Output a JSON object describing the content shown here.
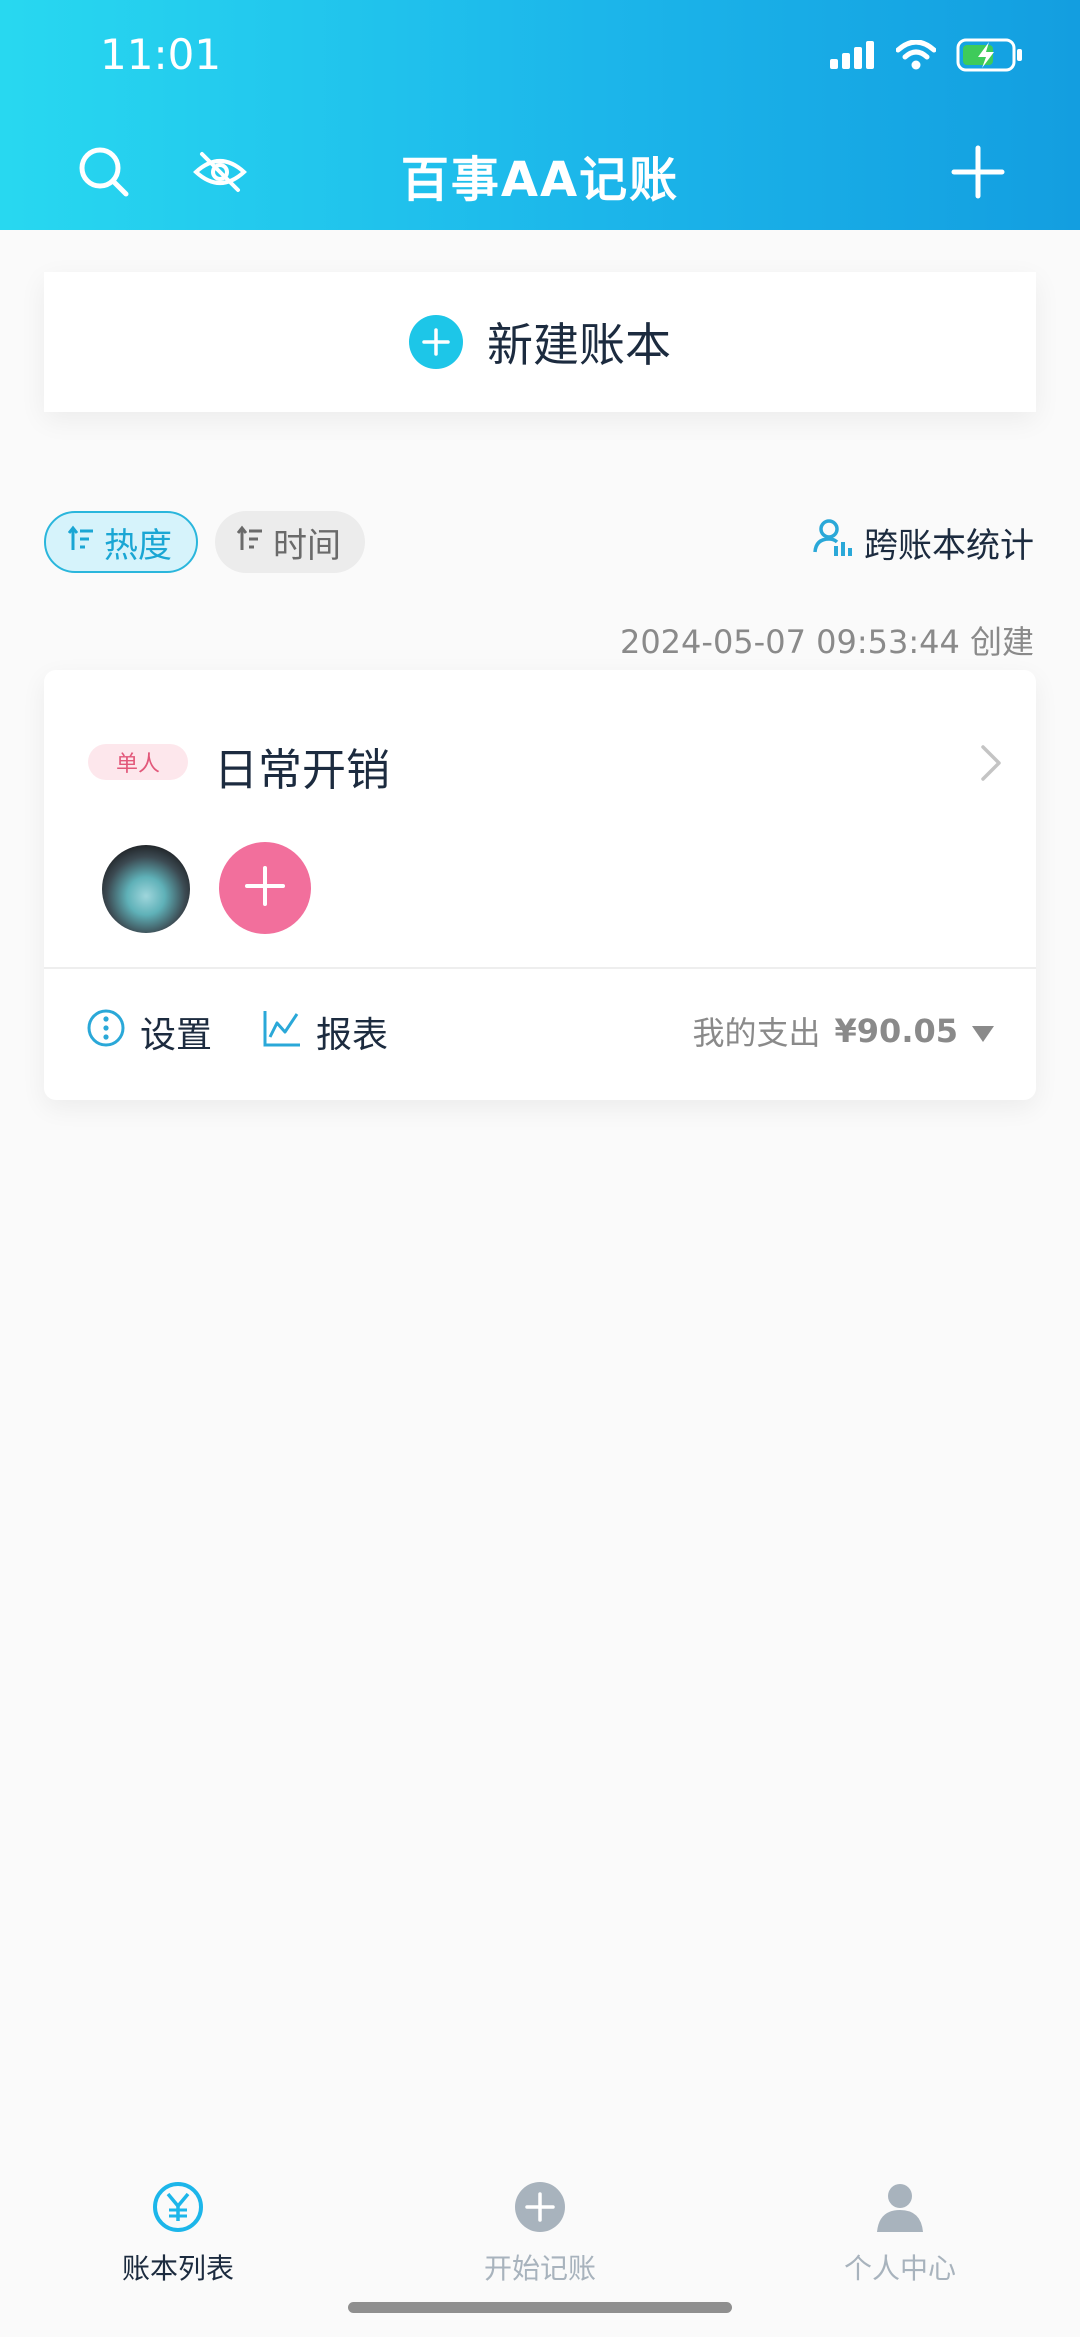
{
  "status": {
    "time": "11:01"
  },
  "header": {
    "title": "百事AA记账"
  },
  "new_book": {
    "label": "新建账本"
  },
  "sort": {
    "hot": "热度",
    "time": "时间"
  },
  "cross_stats": {
    "label": "跨账本统计"
  },
  "book": {
    "created": "2024-05-07 09:53:44 创建",
    "badge": "单人",
    "name": "日常开销",
    "settings_label": "设置",
    "report_label": "报表",
    "spend_label": "我的支出",
    "spend_amount": "¥90.05"
  },
  "tabs": [
    {
      "label": "账本列表",
      "active": true
    },
    {
      "label": "开始记账",
      "active": false
    },
    {
      "label": "个人中心",
      "active": false
    }
  ],
  "colors": {
    "accent": "#1cb6ea",
    "pink": "#f26f9c",
    "text": "#1c2b3f"
  }
}
